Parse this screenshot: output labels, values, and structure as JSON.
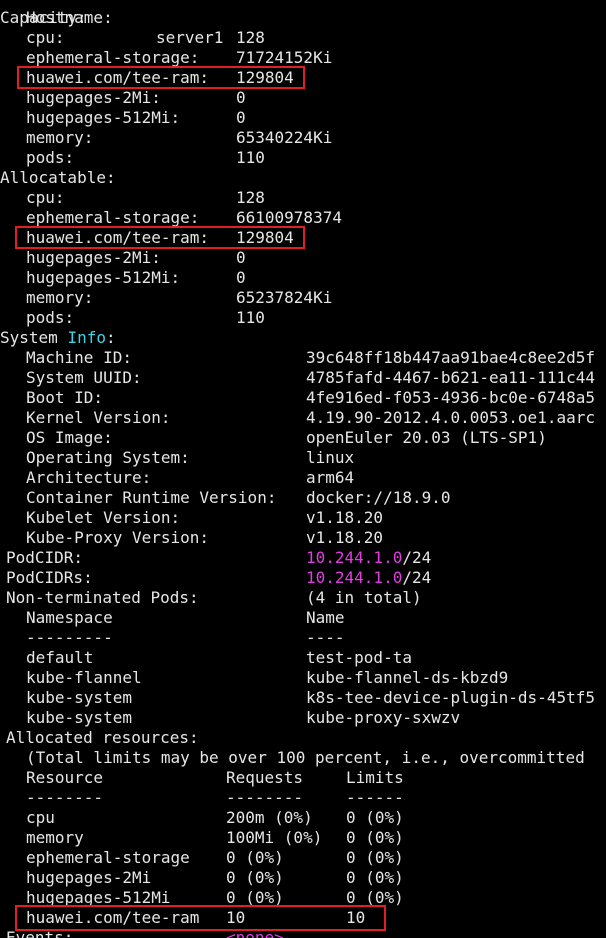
{
  "top_partial": {
    "key": "Hostname:",
    "value": "server1"
  },
  "capacity": {
    "header": "Capacity:",
    "rows": [
      {
        "k": "cpu:",
        "v": "128"
      },
      {
        "k": "ephemeral-storage:",
        "v": "71724152Ki"
      },
      {
        "k": "huawei.com/tee-ram:",
        "v": "129804"
      },
      {
        "k": "hugepages-2Mi:",
        "v": "0"
      },
      {
        "k": "hugepages-512Mi:",
        "v": "0"
      },
      {
        "k": "memory:",
        "v": "65340224Ki"
      },
      {
        "k": "pods:",
        "v": "110"
      }
    ]
  },
  "allocatable": {
    "header": "Allocatable:",
    "rows": [
      {
        "k": "cpu:",
        "v": "128"
      },
      {
        "k": "ephemeral-storage:",
        "v": "66100978374"
      },
      {
        "k": "huawei.com/tee-ram:",
        "v": "129804"
      },
      {
        "k": "hugepages-2Mi:",
        "v": "0"
      },
      {
        "k": "hugepages-512Mi:",
        "v": "0"
      },
      {
        "k": "memory:",
        "v": "65237824Ki"
      },
      {
        "k": "pods:",
        "v": "110"
      }
    ]
  },
  "system_info": {
    "header_prefix": "System ",
    "header_word": "Info",
    "header_suffix": ":",
    "rows": [
      {
        "k": "Machine ID:",
        "v": "39c648ff18b447aa91bae4c8ee2d5f"
      },
      {
        "k": "System UUID:",
        "v": "4785fafd-4467-b621-ea11-111c44"
      },
      {
        "k": "Boot ID:",
        "v": "4fe916ed-f053-4936-bc0e-6748a5"
      },
      {
        "k": "Kernel Version:",
        "v": "4.19.90-2012.4.0.0053.oe1.aarc"
      },
      {
        "k": "OS Image:",
        "v": "openEuler 20.03 (LTS-SP1)"
      },
      {
        "k": "Operating System:",
        "v": "linux"
      },
      {
        "k": "Architecture:",
        "v": "arm64"
      },
      {
        "k": "Container Runtime Version:",
        "v": "docker://18.9.0"
      },
      {
        "k": "Kubelet Version:",
        "v": "v1.18.20"
      },
      {
        "k": "Kube-Proxy Version:",
        "v": "v1.18.20"
      }
    ]
  },
  "podcidr": {
    "k": "PodCIDR:",
    "ip": "10.244.1.0",
    "mask": "/24"
  },
  "podcidrs": {
    "k": "PodCIDRs:",
    "ip": "10.244.1.0",
    "mask": "/24"
  },
  "pods": {
    "header": "Non-terminated Pods:",
    "total": "(4 in total)",
    "col_ns": "Namespace",
    "col_name": "Name",
    "sep_ns": "---------",
    "sep_name": "----",
    "rows": [
      {
        "ns": "default",
        "name": "test-pod-ta"
      },
      {
        "ns": "kube-flannel",
        "name": "kube-flannel-ds-kbzd9"
      },
      {
        "ns": "kube-system",
        "name": "k8s-tee-device-plugin-ds-45tf5"
      },
      {
        "ns": "kube-system",
        "name": "kube-proxy-sxwzv"
      }
    ]
  },
  "allocated": {
    "header": "Allocated resources:",
    "note": "(Total limits may be over 100 percent, i.e., overcommitted",
    "col_resource": "Resource",
    "col_requests": "Requests",
    "col_limits": "Limits",
    "sep_resource": "--------",
    "sep_requests": "--------",
    "sep_limits": "------",
    "rows": [
      {
        "r": "cpu",
        "req": "200m (0%)",
        "lim": "0 (0%)"
      },
      {
        "r": "memory",
        "req": "100Mi (0%)",
        "lim": "0 (0%)"
      },
      {
        "r": "ephemeral-storage",
        "req": "0 (0%)",
        "lim": "0 (0%)"
      },
      {
        "r": "hugepages-2Mi",
        "req": "0 (0%)",
        "lim": "0 (0%)"
      },
      {
        "r": "hugepages-512Mi",
        "req": "0 (0%)",
        "lim": "0 (0%)"
      },
      {
        "r": "huawei.com/tee-ram",
        "req": "10",
        "lim": "10"
      }
    ]
  },
  "events_partial": {
    "k": "Events:",
    "v": "<none>"
  },
  "colors": {
    "highlight_box": "#e02020",
    "info_word": "#3fd3e6",
    "cidr_ip": "#e13de1"
  }
}
